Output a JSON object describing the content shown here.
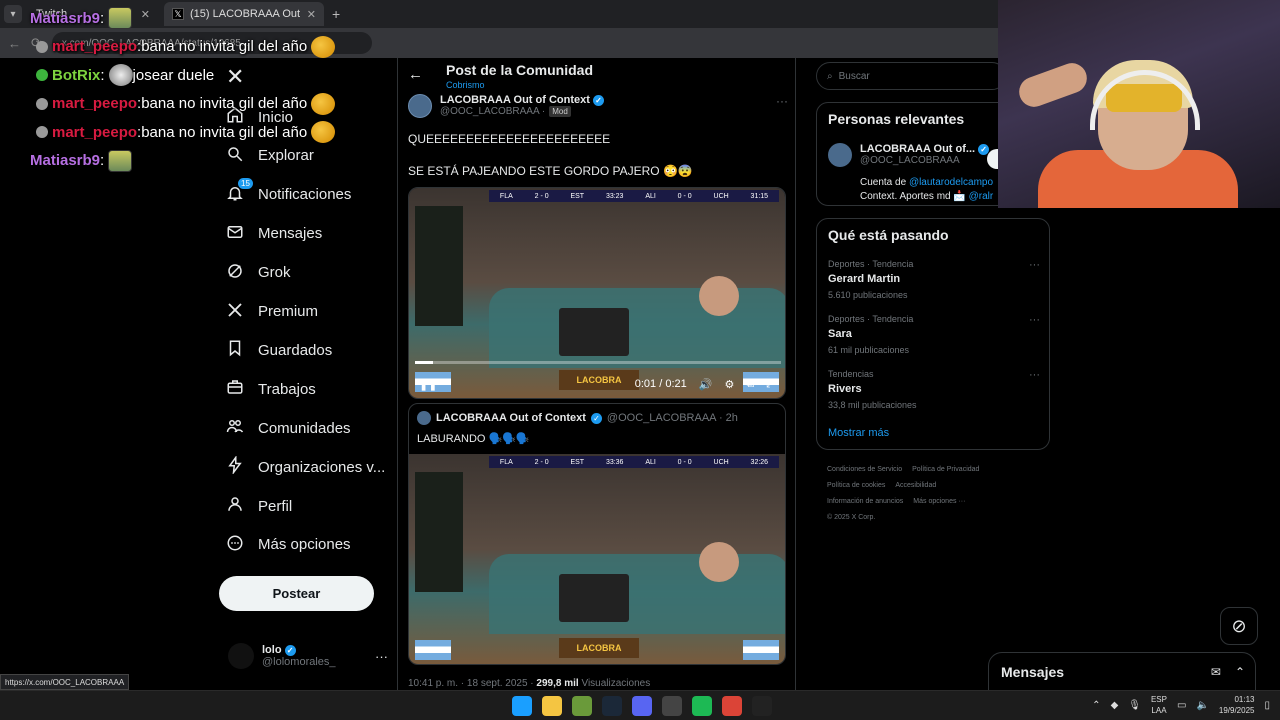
{
  "browser": {
    "tabs": [
      {
        "title": "Twitch",
        "active": false
      },
      {
        "title": "(15) LACOBRAAA Out of Conte",
        "active": true
      }
    ],
    "omnibox": "x.com/OOC_LACOBRAAA/status/19685...",
    "status_url": "https://x.com/OOC_LACOBRAAA"
  },
  "chat": {
    "lines": [
      {
        "user": "Matiasrb9",
        "user_color": "#b66fe2",
        "message": "",
        "emote": "sponge",
        "badge": ""
      },
      {
        "user": "mart_peepo",
        "user_color": "#d81b41",
        "message": "bana no invita gil del año",
        "emote": "duck",
        "badge": "#999"
      },
      {
        "user": "BotRix",
        "user_color": "#7dd33f",
        "message": "josear duele",
        "emote": "face",
        "badge": "#3db33d"
      },
      {
        "user": "mart_peepo",
        "user_color": "#d81b41",
        "message": "bana no invita gil del año",
        "emote": "duck",
        "badge": "#999"
      },
      {
        "user": "mart_peepo",
        "user_color": "#d81b41",
        "message": "bana no invita gil del año",
        "emote": "duck",
        "badge": "#999"
      },
      {
        "user": "Matiasrb9",
        "user_color": "#b66fe2",
        "message": "",
        "emote": "sponge",
        "badge": ""
      }
    ]
  },
  "nav": {
    "items": [
      {
        "label": "Inicio",
        "icon": "home-icon"
      },
      {
        "label": "Explorar",
        "icon": "search-icon"
      },
      {
        "label": "Notificaciones",
        "icon": "bell-icon",
        "badge": "15"
      },
      {
        "label": "Mensajes",
        "icon": "mail-icon"
      },
      {
        "label": "Grok",
        "icon": "grok-icon"
      },
      {
        "label": "Premium",
        "icon": "x-icon"
      },
      {
        "label": "Guardados",
        "icon": "bookmark-icon"
      },
      {
        "label": "Trabajos",
        "icon": "briefcase-icon"
      },
      {
        "label": "Comunidades",
        "icon": "people-icon"
      },
      {
        "label": "Organizaciones v...",
        "icon": "lightning-icon"
      },
      {
        "label": "Perfil",
        "icon": "person-icon"
      },
      {
        "label": "Más opciones",
        "icon": "more-circle-icon"
      }
    ],
    "post_button": "Postear",
    "account": {
      "name": "lolo",
      "handle": "@lolomorales_"
    }
  },
  "main": {
    "title": "Post de la Comunidad",
    "subtitle": "Cobrismo",
    "post": {
      "author": "LACOBRAAA Out of Context",
      "handle": "@OOC_LACOBRAAA",
      "separator": "·",
      "role": "Mod",
      "text1": "QUEEEEEEEEEEEEEEEEEEEEEEE",
      "text2": "SE ESTÁ PAJEANDO ESTE GORDO PAJERO 😳😨",
      "video": {
        "time": "0:01 / 0:21",
        "progress": 0.05,
        "scoreboard": [
          "FLA",
          "2 - 0",
          "EST",
          "33:23",
          "ALI",
          "0 - 0",
          "UCH",
          "31:15"
        ],
        "overlay_brand": "LACOBRA"
      },
      "quoted": {
        "author": "LACOBRAAA Out of Context",
        "handle_time": "@OOC_LACOBRAAA · 2h",
        "text": "LABURANDO 🗣️🗣️🗣️",
        "scoreboard": [
          "FLA",
          "2 - 0",
          "EST",
          "33:36",
          "ALI",
          "0 - 0",
          "UCH",
          "32:26"
        ],
        "overlay_brand": "LACOBRA"
      },
      "meta_time": "10:41 p. m. · 18 sept. 2025 ·",
      "views_count": "299,8 mil",
      "views_label": "Visualizaciones"
    }
  },
  "sidebar": {
    "search_placeholder": "Buscar",
    "relevant": {
      "title": "Personas relevantes",
      "name": "LACOBRAAA Out of...",
      "handle": "@OOC_LACOBRAAA",
      "bio_prefix": "Cuenta de",
      "bio_link1": "@lautarodelcampo",
      "bio_mid": "Context. Aportes md 📩",
      "bio_link2": "@ralr"
    },
    "trends": {
      "title": "Qué está pasando",
      "items": [
        {
          "category": "Deportes · Tendencia",
          "name": "Gerard Martin",
          "count": "5.610 publicaciones"
        },
        {
          "category": "Deportes · Tendencia",
          "name": "Sara",
          "count": "61 mil publicaciones"
        },
        {
          "category": "Tendencias",
          "name": "Rivers",
          "count": "33,8 mil publicaciones"
        }
      ],
      "show_more": "Mostrar más"
    },
    "footer": [
      "Condiciones de Servicio",
      "Política de Privacidad",
      "Política de cookies",
      "Accesibilidad",
      "Información de anuncios",
      "Más opciones ···",
      "© 2025 X Corp."
    ]
  },
  "messages_drawer": {
    "title": "Mensajes"
  },
  "taskbar": {
    "lang": "ESP",
    "lang2": "LAA",
    "time": "01:13",
    "date": "19/9/2025",
    "apps": [
      {
        "name": "windows-start",
        "color": "#1a9fff"
      },
      {
        "name": "file-explorer",
        "color": "#f4c542"
      },
      {
        "name": "minecraft",
        "color": "#6a9a3a"
      },
      {
        "name": "steam",
        "color": "#1b2838"
      },
      {
        "name": "discord",
        "color": "#5865f2"
      },
      {
        "name": "obs",
        "color": "#444"
      },
      {
        "name": "spotify",
        "color": "#1db954"
      },
      {
        "name": "chrome",
        "color": "#db4437"
      },
      {
        "name": "kick",
        "color": "#222"
      }
    ]
  }
}
